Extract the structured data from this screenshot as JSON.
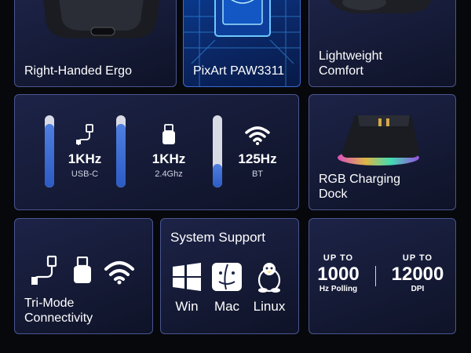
{
  "features": {
    "ergo_label": "Right-Handed Ergo",
    "sensor_label": "PixArt PAW3311",
    "light_label": "Lightweight\nComfort",
    "dock_label": "RGB Charging\nDock",
    "tri_label": "Tri-Mode\nConnectivity"
  },
  "modes": [
    {
      "value": "1KHz",
      "sub": "USB-C",
      "icon": "usb-cable-icon",
      "fill": 0.88
    },
    {
      "value": "1KHz",
      "sub": "2.4Ghz",
      "icon": "usb-dongle-icon",
      "fill": 0.88
    },
    {
      "value": "125Hz",
      "sub": "BT",
      "icon": "wifi-icon",
      "fill": 0.33
    }
  ],
  "system": {
    "title": "System Support",
    "os": [
      {
        "label": "Win",
        "icon": "windows-icon"
      },
      {
        "label": "Mac",
        "icon": "finder-icon"
      },
      {
        "label": "Linux",
        "icon": "tux-penguin-icon"
      }
    ]
  },
  "specs": {
    "left": {
      "up": "UP TO",
      "num": "1000",
      "unit": "Hz Polling"
    },
    "right": {
      "up": "UP TO",
      "num": "12000",
      "unit": "DPI"
    }
  },
  "colors": {
    "accent": "#3a6fd8",
    "card_border": "#4a5590"
  }
}
